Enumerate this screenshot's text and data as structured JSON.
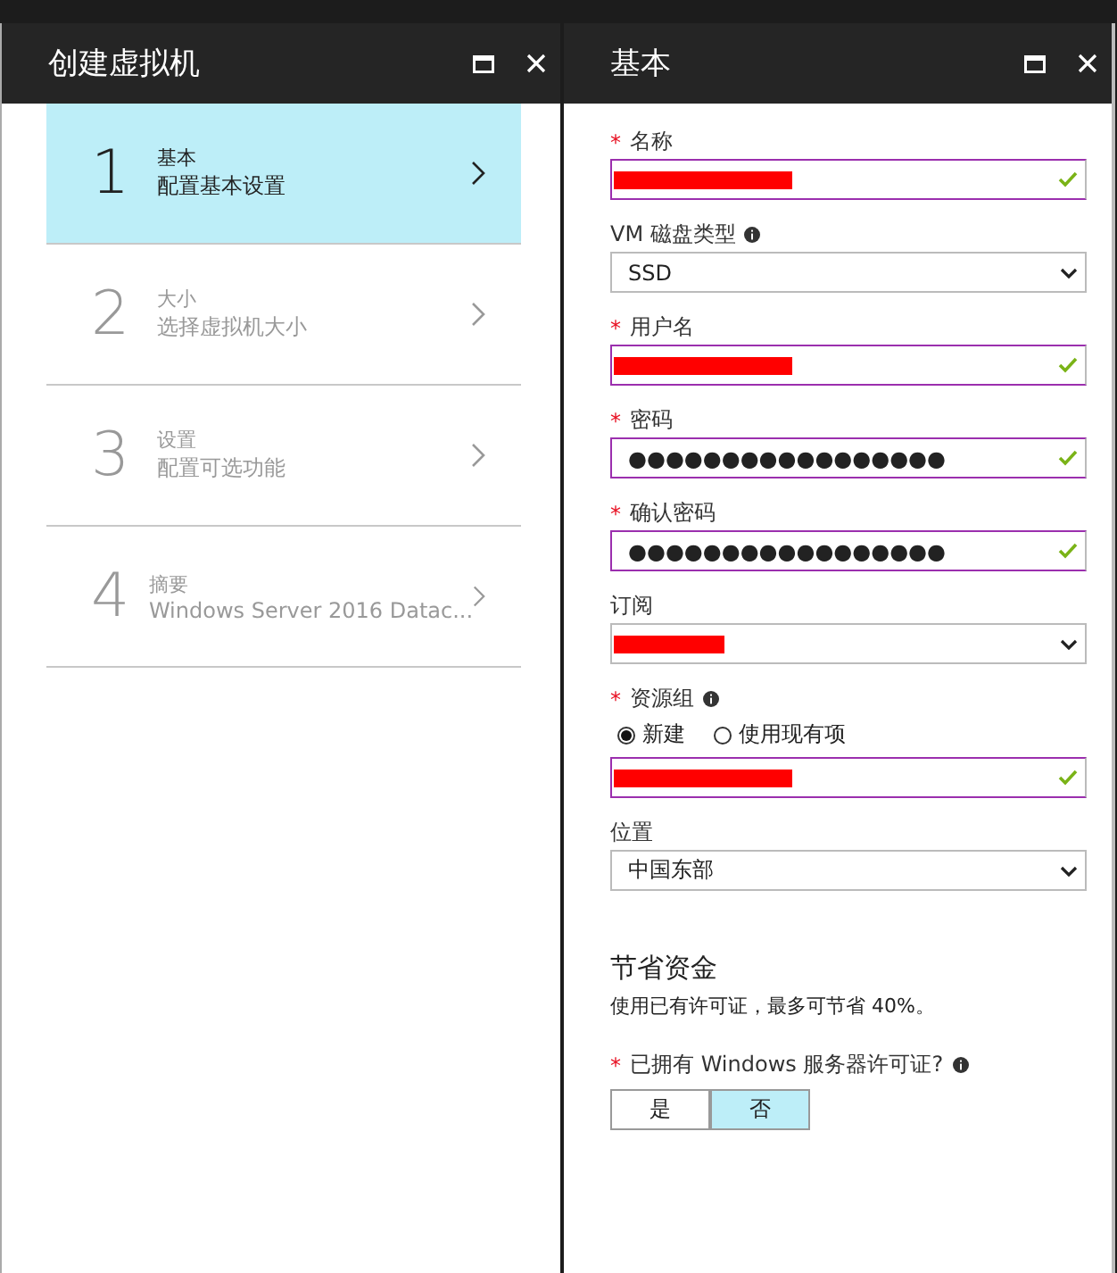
{
  "left_blade": {
    "title": "创建虚拟机",
    "steps": [
      {
        "number": "1",
        "title": "基本",
        "subtitle": "配置基本设置",
        "selected": true
      },
      {
        "number": "2",
        "title": "大小",
        "subtitle": "选择虚拟机大小",
        "selected": false
      },
      {
        "number": "3",
        "title": "设置",
        "subtitle": "配置可选功能",
        "selected": false
      },
      {
        "number": "4",
        "title": "摘要",
        "subtitle": "Windows Server 2016 Datac...",
        "selected": false
      }
    ]
  },
  "right_blade": {
    "title": "基本",
    "fields": [
      {
        "kind": "text",
        "required_mark": "*",
        "label": "名称",
        "redacted": true,
        "valid": true
      },
      {
        "kind": "select",
        "label": "VM 磁盘类型",
        "info": true,
        "value": "SSD"
      },
      {
        "kind": "text",
        "required_mark": "*",
        "label": "用户名",
        "redacted": true,
        "valid": true
      },
      {
        "kind": "text",
        "required_mark": "*",
        "label": "密码",
        "value": "●●●●●●●●●●●●●●●●●",
        "valid": true
      },
      {
        "kind": "text",
        "required_mark": "*",
        "label": "确认密码",
        "value": "●●●●●●●●●●●●●●●●●",
        "valid": true
      },
      {
        "kind": "select",
        "label": "订阅",
        "redacted": true
      },
      {
        "kind": "radio",
        "required_mark": "*",
        "label": "资源组",
        "info": true,
        "options": [
          {
            "label": "新建",
            "selected": true
          },
          {
            "label": "使用现有项",
            "selected": false
          }
        ],
        "redacted": true,
        "valid": true
      },
      {
        "kind": "select",
        "label": "位置",
        "value": "中国东部"
      }
    ],
    "savings": {
      "title": "节省资金",
      "description": "使用已有许可证，最多可节省 40%。",
      "required_mark": "*",
      "question": "已拥有 Windows 服务器许可证?",
      "info": true,
      "options": [
        {
          "label": "是",
          "selected": false
        },
        {
          "label": "否",
          "selected": true
        }
      ]
    }
  }
}
